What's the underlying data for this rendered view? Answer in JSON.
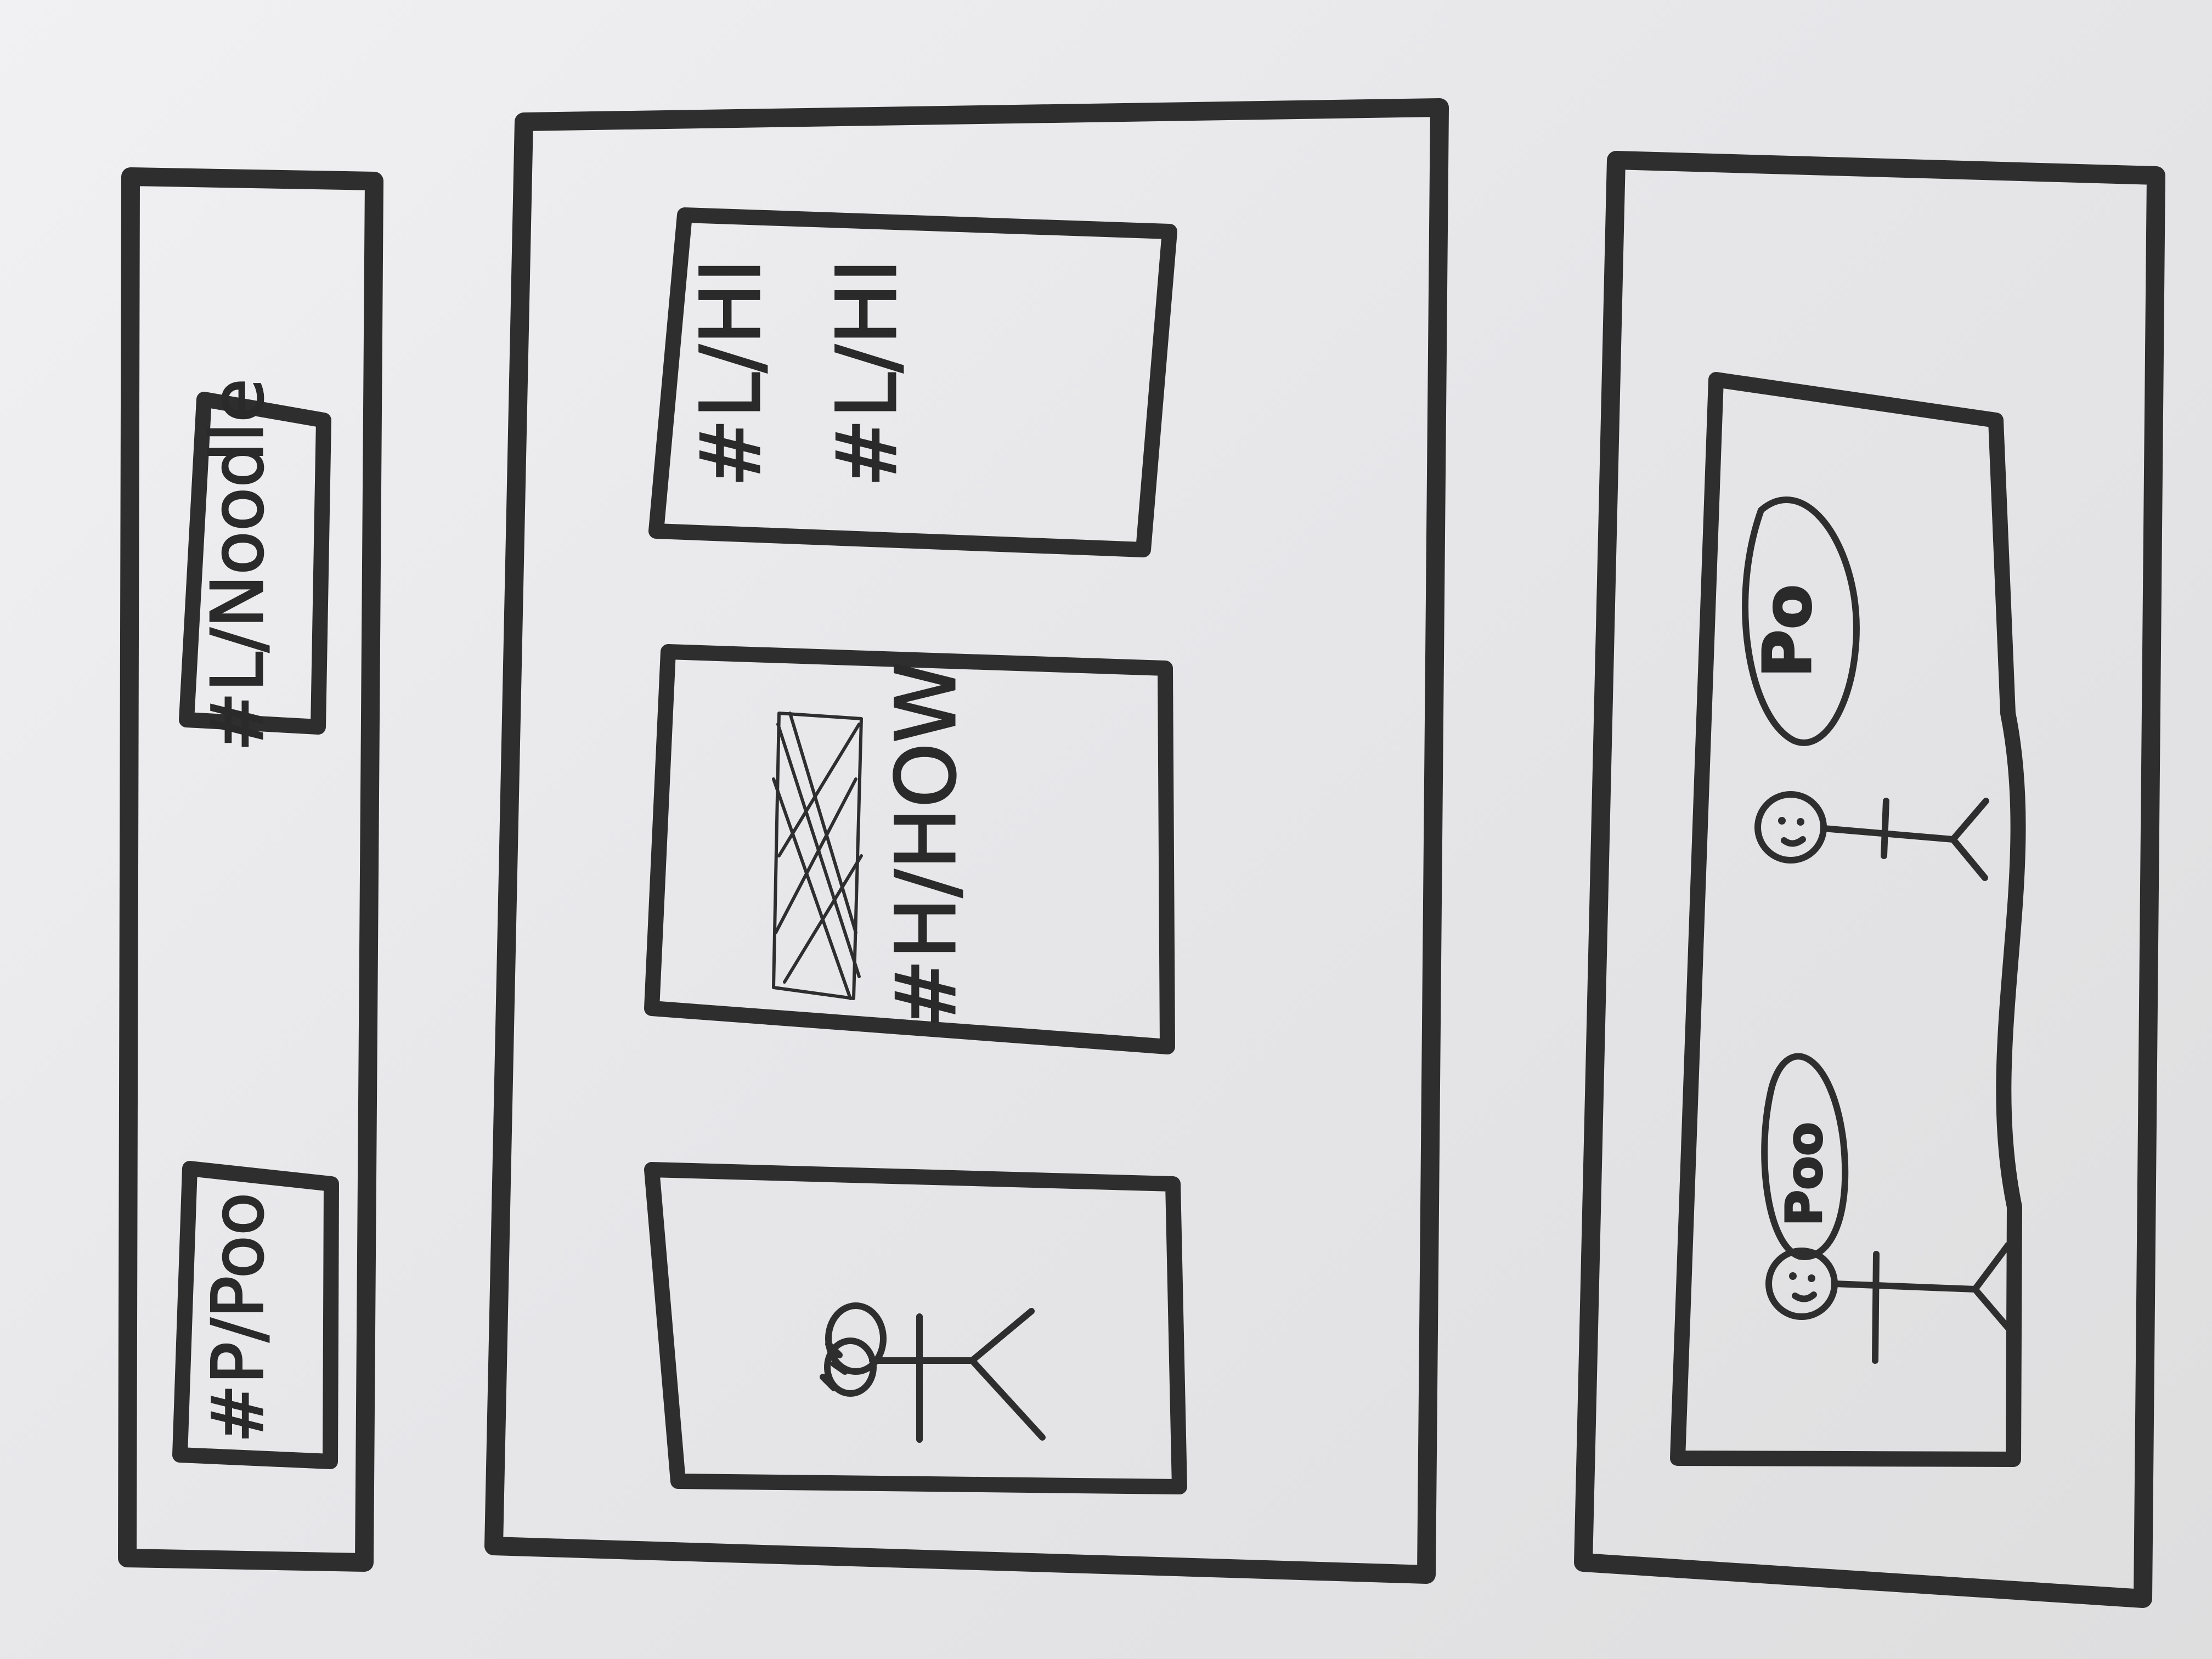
{
  "sketch": {
    "left_panel": {
      "chips": [
        {
          "label": "#L/Noodle"
        },
        {
          "label": "#P/Poo"
        }
      ]
    },
    "middle_panel": {
      "cards": [
        {
          "lines": [
            "#L/HI",
            "#L/HI"
          ]
        },
        {
          "lines": [
            "#H/HOW"
          ]
        },
        {
          "lines": []
        }
      ]
    },
    "right_panel": {
      "bubbles": [
        {
          "label": "Po"
        },
        {
          "label": "Poo"
        }
      ]
    }
  },
  "colors": {
    "paper": "#ebebed",
    "ink": "#2e2e2e"
  }
}
